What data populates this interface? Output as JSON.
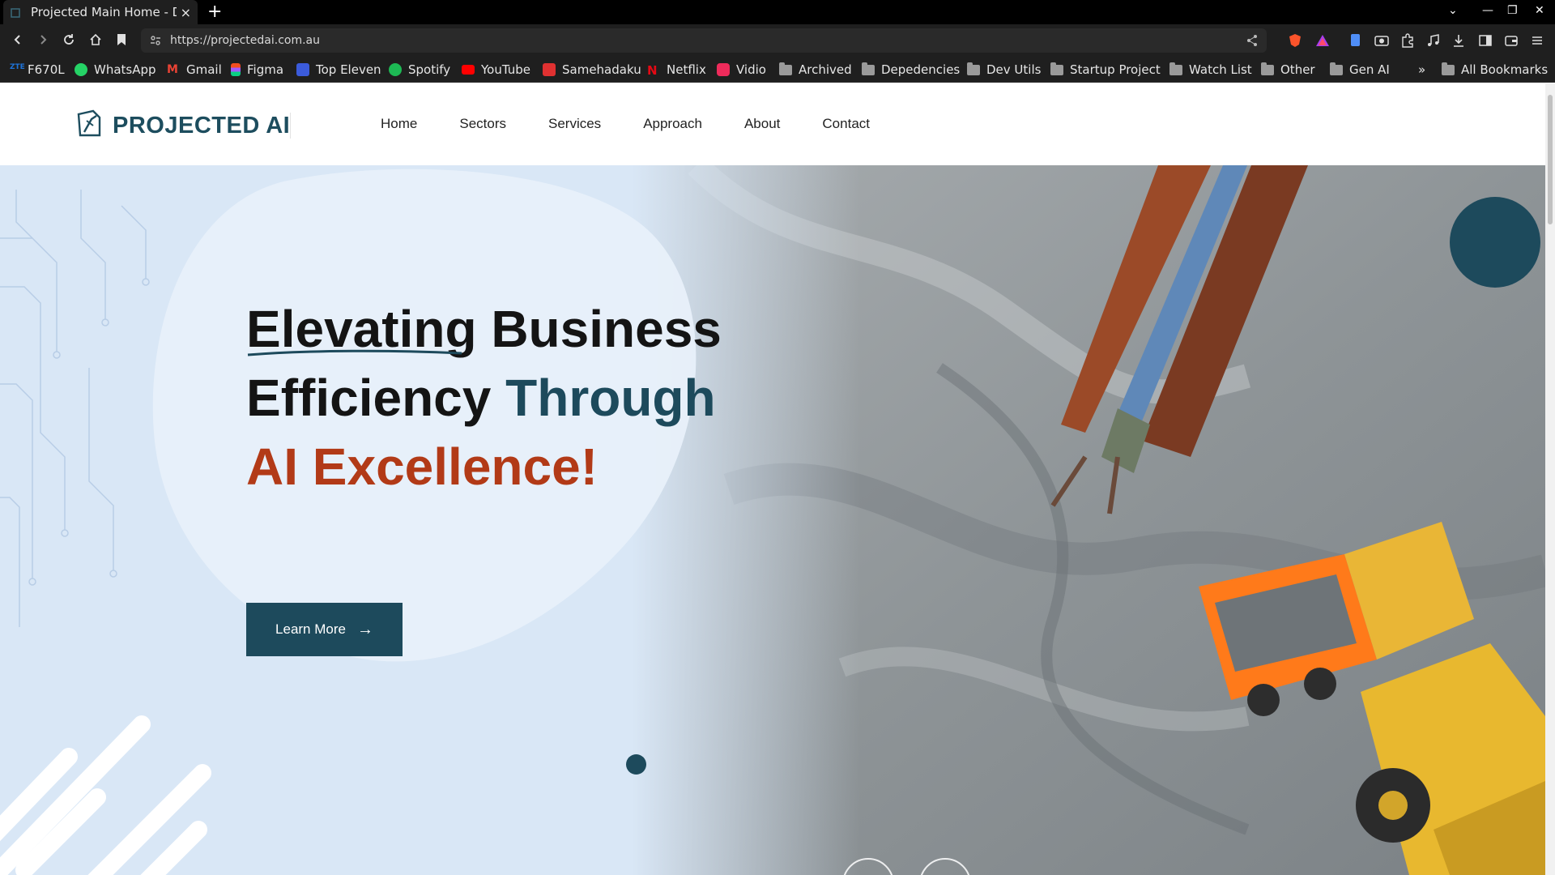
{
  "browser": {
    "tab_title": "Projected Main Home - De",
    "tab_close": "×",
    "new_tab": "+",
    "url": "https://projectedai.com.au",
    "window_controls": [
      "⌄",
      "—",
      "❐",
      "✕"
    ],
    "bookmarks": [
      {
        "label": "F670L",
        "icon": "zte-icon",
        "color": "#1e73d8"
      },
      {
        "label": "WhatsApp",
        "icon": "whatsapp-icon",
        "color": "#25d366"
      },
      {
        "label": "Gmail",
        "icon": "gmail-icon",
        "color": "#ea4335"
      },
      {
        "label": "Figma",
        "icon": "figma-icon",
        "color": "#a259ff"
      },
      {
        "label": "Top Eleven",
        "icon": "top-eleven-icon",
        "color": "#3b5bdb"
      },
      {
        "label": "Spotify",
        "icon": "spotify-icon",
        "color": "#1db954"
      },
      {
        "label": "YouTube",
        "icon": "youtube-icon",
        "color": "#ff0000"
      },
      {
        "label": "Samehadaku",
        "icon": "samehadaku-icon",
        "color": "#e03131"
      },
      {
        "label": "Netflix",
        "icon": "netflix-icon",
        "color": "#e50914"
      },
      {
        "label": "Vidio",
        "icon": "vidio-icon",
        "color": "#ee2b5b"
      },
      {
        "label": "Archived",
        "icon": "folder-icon"
      },
      {
        "label": "Depedencies",
        "icon": "folder-icon"
      },
      {
        "label": "Dev Utils",
        "icon": "folder-icon"
      },
      {
        "label": "Startup Project",
        "icon": "folder-icon"
      },
      {
        "label": "Watch List",
        "icon": "folder-icon"
      },
      {
        "label": "Other",
        "icon": "folder-icon"
      },
      {
        "label": "Gen AI",
        "icon": "folder-icon"
      }
    ],
    "overflow": "»",
    "all_bookmarks": "All Bookmarks"
  },
  "site": {
    "logo_text": "PROJECTED AI",
    "nav": [
      "Home",
      "Sectors",
      "Services",
      "Approach",
      "About",
      "Contact"
    ]
  },
  "hero": {
    "line1": "Elevating Business",
    "line2_a": "Efficiency ",
    "line2_b": "Through",
    "line3": "AI Excellence!",
    "cta": "Learn More",
    "cta_arrow": "→",
    "prev_arrow": "←",
    "next_arrow": "→"
  },
  "colors": {
    "brand_teal": "#1d4a5c",
    "accent_rust": "#b23a17",
    "hero_bg": "#d9e7f6"
  }
}
